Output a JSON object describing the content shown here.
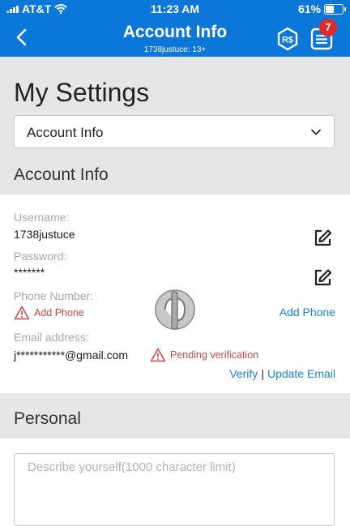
{
  "status_bar": {
    "carrier": "AT&T",
    "time": "11:23 AM",
    "battery": "61%",
    "battery_level": 0.61
  },
  "nav": {
    "title": "Account Info",
    "subtitle": "1738justuce: 13+",
    "notification_count": "7",
    "robux_label": "R$"
  },
  "page_title": "My Settings",
  "settings_dropdown": {
    "selected": "Account Info"
  },
  "account_section": {
    "heading": "Account Info",
    "username_label": "Username:",
    "username": "1738justuce",
    "password_label": "Password:",
    "password": "*******",
    "phone_label": "Phone Number:",
    "phone_warning": "Add Phone",
    "add_phone_link": "Add Phone",
    "email_label": "Email address:",
    "email": "j***********@gmail.com",
    "email_status": "Pending verification",
    "verify_link": "Verify",
    "separator": "|",
    "update_email_link": "Update Email"
  },
  "personal_section": {
    "heading": "Personal",
    "description_placeholder": "Describe yourself(1000 character limit)"
  },
  "colors": {
    "brand_blue": "#0b77d8",
    "badge_red": "#e0292a",
    "warning_red": "#d14848",
    "link_blue": "#1a82e2",
    "section_gray": "#e6e6e6"
  }
}
